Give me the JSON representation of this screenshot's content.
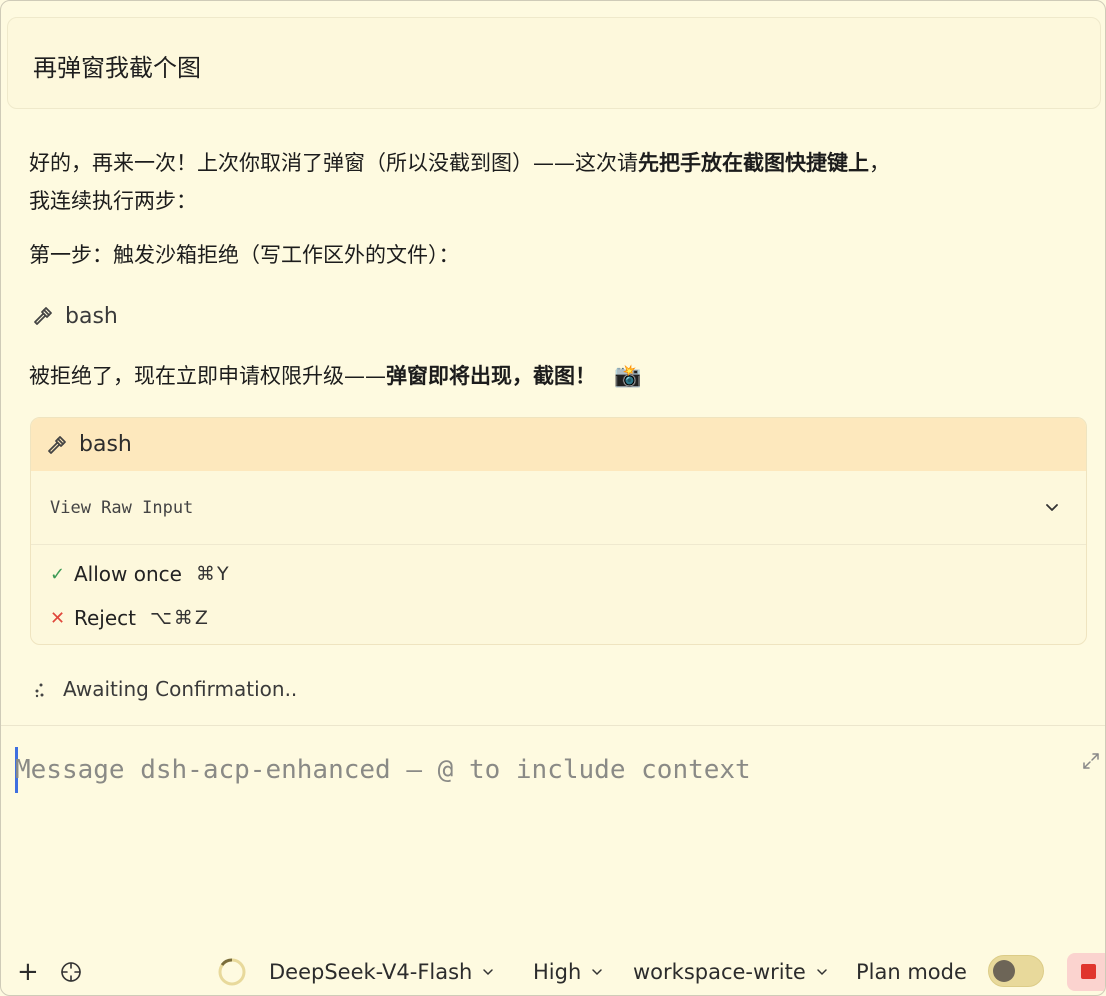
{
  "user_message": "再弹窗我截个图",
  "assistant": {
    "intro_pre": "好的，再来一次！上次你取消了弹窗（所以没截到图）——这次请",
    "intro_bold": "先把手放在截图快捷键上",
    "intro_post": "，",
    "intro_line2": "我连续执行两步：",
    "step1": "第一步：触发沙箱拒绝（写工作区外的文件）：",
    "tool1_label": "bash",
    "rejected_pre": "被拒绝了，现在立即申请权限升级——",
    "rejected_bold": "弹窗即将出现，截图！",
    "camera_emoji": "📸"
  },
  "permission": {
    "tool_label": "bash",
    "raw_input_label": "View Raw Input",
    "allow_mark": "✓",
    "allow_label": "Allow once",
    "allow_shortcut": "⌘Y",
    "reject_mark": "✕",
    "reject_label": "Reject",
    "reject_shortcut": "⌥⌘Z"
  },
  "status_text": "Awaiting Confirmation..",
  "composer": {
    "placeholder": "Message dsh-acp-enhanced — @ to include context"
  },
  "toolbar": {
    "plus": "+",
    "model": "DeepSeek-V4-Flash",
    "effort": "High",
    "sandbox": "workspace-write",
    "plan_mode_label": "Plan mode",
    "plan_mode_on": false
  }
}
